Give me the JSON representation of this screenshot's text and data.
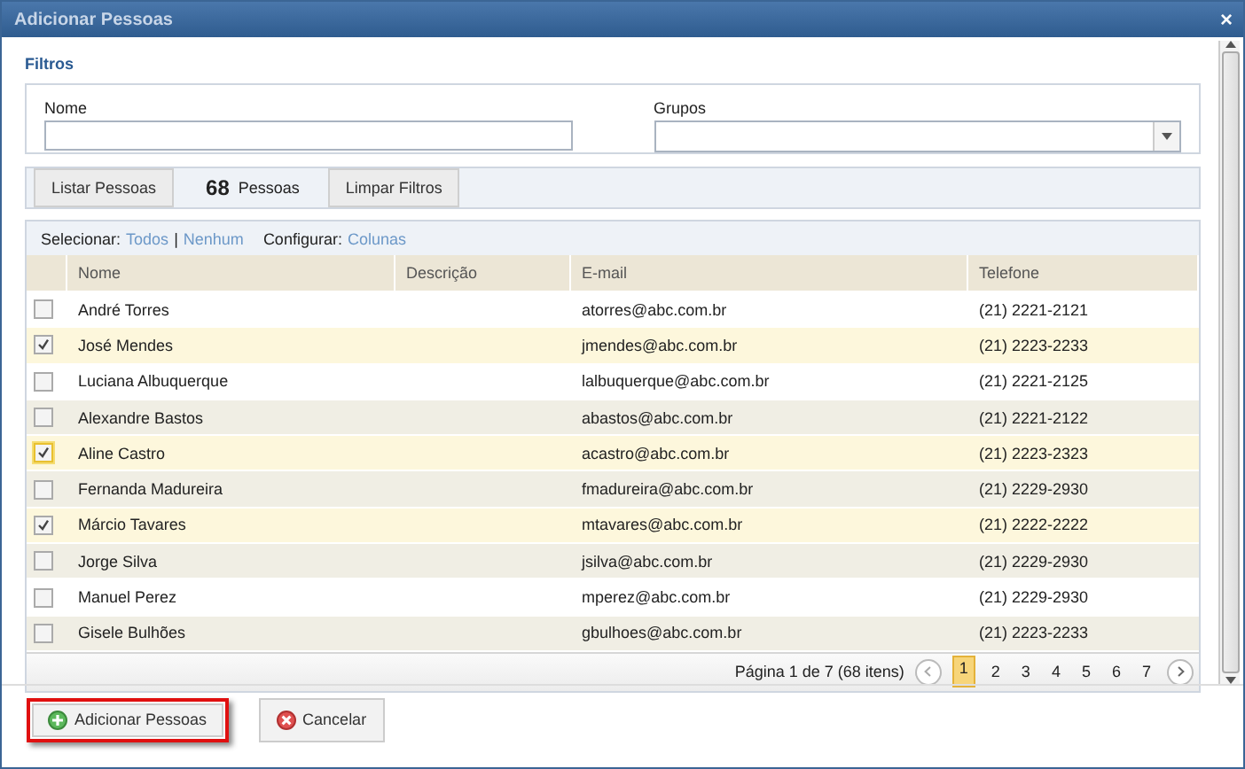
{
  "window": {
    "title": "Adicionar Pessoas",
    "close": "×"
  },
  "filters": {
    "title": "Filtros",
    "fields": [
      {
        "kind": "text",
        "label": "Nome"
      },
      {
        "kind": "select",
        "label": "Grupos"
      }
    ]
  },
  "toolbar": {
    "list_button": "Listar Pessoas",
    "count": "68",
    "count_label": "Pessoas",
    "clear_button": "Limpar Filtros"
  },
  "selection_bar": {
    "select_label": "Selecionar:",
    "all": "Todos",
    "separator": "|",
    "none": "Nenhum",
    "configure_label": "Configurar:",
    "columns": "Colunas"
  },
  "table": {
    "columns": [
      "Nome",
      "Descrição",
      "E-mail",
      "Telefone"
    ],
    "rows": [
      {
        "checked": false,
        "focused": false,
        "cells": [
          "André Torres",
          "",
          "atorres@abc.com.br",
          "(21) 2221-2121"
        ]
      },
      {
        "checked": true,
        "focused": false,
        "cells": [
          "José Mendes",
          "",
          "jmendes@abc.com.br",
          "(21) 2223-2233"
        ]
      },
      {
        "checked": false,
        "focused": false,
        "cells": [
          "Luciana Albuquerque",
          "",
          "lalbuquerque@abc.com.br",
          "(21) 2221-2125"
        ]
      },
      {
        "checked": false,
        "focused": false,
        "cells": [
          "Alexandre Bastos",
          "",
          "abastos@abc.com.br",
          "(21) 2221-2122"
        ]
      },
      {
        "checked": true,
        "focused": true,
        "cells": [
          "Aline Castro",
          "",
          "acastro@abc.com.br",
          "(21) 2223-2323"
        ]
      },
      {
        "checked": false,
        "focused": false,
        "cells": [
          "Fernanda Madureira",
          "",
          "fmadureira@abc.com.br",
          "(21) 2229-2930"
        ]
      },
      {
        "checked": true,
        "focused": false,
        "cells": [
          "Márcio Tavares",
          "",
          "mtavares@abc.com.br",
          "(21) 2222-2222"
        ]
      },
      {
        "checked": false,
        "focused": false,
        "cells": [
          "Jorge Silva",
          "",
          "jsilva@abc.com.br",
          "(21) 2229-2930"
        ]
      },
      {
        "checked": false,
        "focused": false,
        "cells": [
          "Manuel Perez",
          "",
          "mperez@abc.com.br",
          "(21) 2229-2930"
        ]
      },
      {
        "checked": false,
        "focused": false,
        "cells": [
          "Gisele Bulhões",
          "",
          "gbulhoes@abc.com.br",
          "(21) 2223-2233"
        ]
      }
    ]
  },
  "pager": {
    "summary": "Página 1 de 7 (68 itens)",
    "pages": [
      {
        "label": "1",
        "selected": true
      },
      {
        "label": "2",
        "selected": false
      },
      {
        "label": "3",
        "selected": false
      },
      {
        "label": "4",
        "selected": false
      },
      {
        "label": "5",
        "selected": false
      },
      {
        "label": "6",
        "selected": false
      },
      {
        "label": "7",
        "selected": false
      }
    ]
  },
  "footer": {
    "buttons": [
      {
        "kind": "add",
        "label": "Adicionar Pessoas",
        "highlighted": true
      },
      {
        "kind": "cancel",
        "label": "Cancelar",
        "highlighted": false
      }
    ]
  }
}
